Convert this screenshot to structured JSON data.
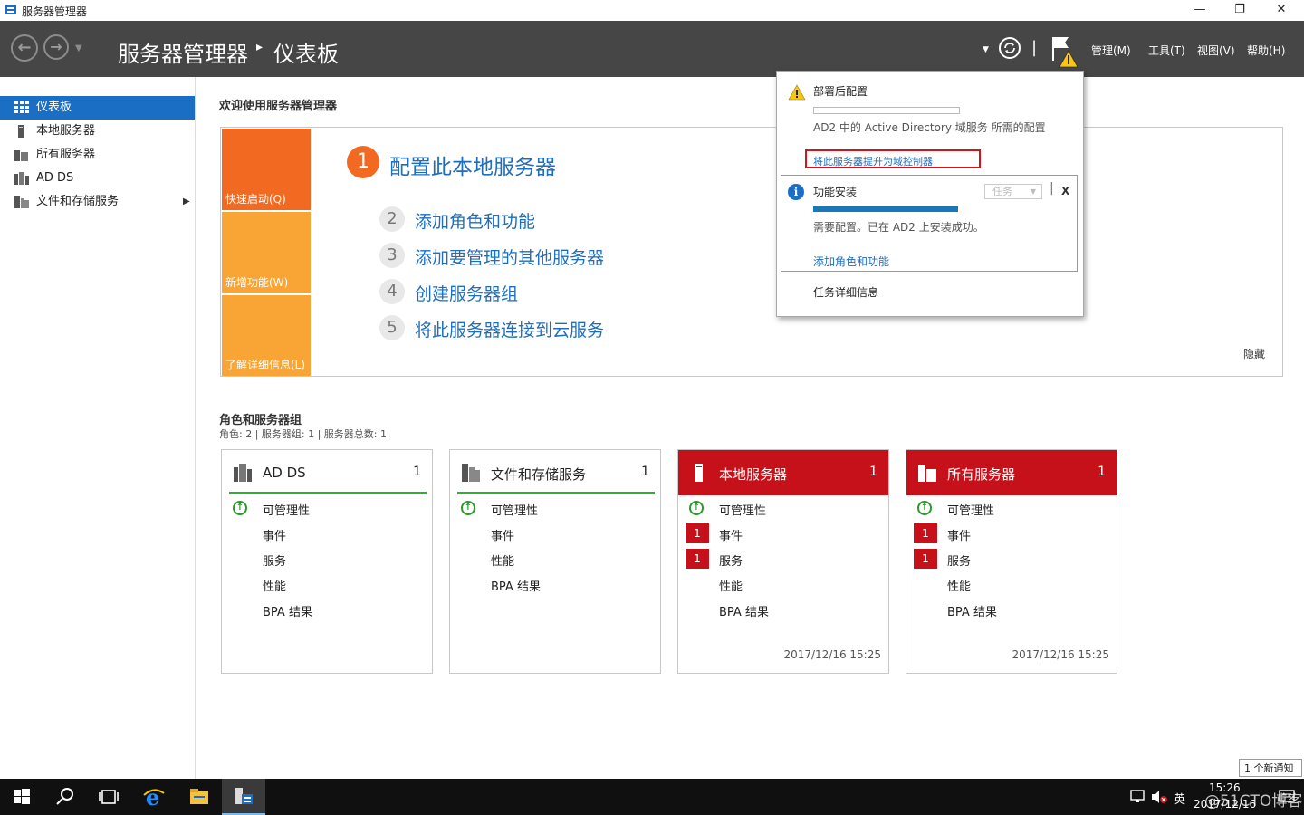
{
  "window": {
    "title": "服务器管理器"
  },
  "header": {
    "breadcrumb": [
      "服务器管理器",
      "仪表板"
    ],
    "menu": [
      "管理(M)",
      "工具(T)",
      "视图(V)",
      "帮助(H)"
    ]
  },
  "sidebar": {
    "items": [
      {
        "label": "仪表板",
        "icon": "dashboard-icon",
        "active": true
      },
      {
        "label": "本地服务器",
        "icon": "server-icon"
      },
      {
        "label": "所有服务器",
        "icon": "servers-icon"
      },
      {
        "label": "AD DS",
        "icon": "ad-ds-icon"
      },
      {
        "label": "文件和存储服务",
        "icon": "file-storage-icon"
      }
    ]
  },
  "main": {
    "welcome": "欢迎使用服务器管理器",
    "quickstart": {
      "tiles": [
        "快速启动(Q)",
        "新增功能(W)",
        "了解详细信息(L)"
      ],
      "tile_colors": [
        "#f26a21",
        "#f8a535",
        "#f8a535"
      ],
      "steps": [
        {
          "num": "1",
          "label": "配置此本地服务器"
        },
        {
          "num": "2",
          "label": "添加角色和功能"
        },
        {
          "num": "3",
          "label": "添加要管理的其他服务器"
        },
        {
          "num": "4",
          "label": "创建服务器组"
        },
        {
          "num": "5",
          "label": "将此服务器连接到云服务"
        }
      ],
      "hide": "隐藏"
    },
    "roles": {
      "title": "角色和服务器组",
      "summary": "角色: 2 | 服务器组: 1 | 服务器总数: 1",
      "cards": [
        {
          "title": "AD DS",
          "count": "1",
          "rows": [
            "可管理性",
            "事件",
            "服务",
            "性能",
            "BPA 结果"
          ]
        },
        {
          "title": "文件和存储服务",
          "count": "1",
          "rows": [
            "可管理性",
            "事件",
            "性能",
            "BPA 结果"
          ]
        },
        {
          "title": "本地服务器",
          "count": "1",
          "rows": [
            "可管理性",
            "事件",
            "服务",
            "性能",
            "BPA 结果"
          ],
          "badges": [
            "1",
            "1"
          ],
          "timestamp": "2017/12/16 15:25"
        },
        {
          "title": "所有服务器",
          "count": "1",
          "rows": [
            "可管理性",
            "事件",
            "服务",
            "性能",
            "BPA 结果"
          ],
          "badges": [
            "1",
            "1"
          ],
          "timestamp": "2017/12/16 15:25"
        }
      ]
    }
  },
  "notifications": {
    "post_deploy": {
      "title": "部署后配置",
      "desc": "AD2 中的 Active Directory 域服务 所需的配置",
      "link": "将此服务器提升为域控制器"
    },
    "feature_install": {
      "title": "功能安装",
      "task_label": "任务",
      "close": "X",
      "desc": "需要配置。已在 AD2 上安装成功。",
      "link": "添加角色和功能",
      "progress": 1.0
    },
    "task_details": "任务详细信息",
    "new_notice": "1 个新通知"
  },
  "taskbar": {
    "ime": "英",
    "time": "15:26",
    "date": "2017/12/16",
    "watermark": "@51CTO博客"
  },
  "colors": {
    "accent": "#1a6fc4",
    "alert": "#c7111a",
    "ok": "#2cb52c",
    "header": "#464646"
  }
}
